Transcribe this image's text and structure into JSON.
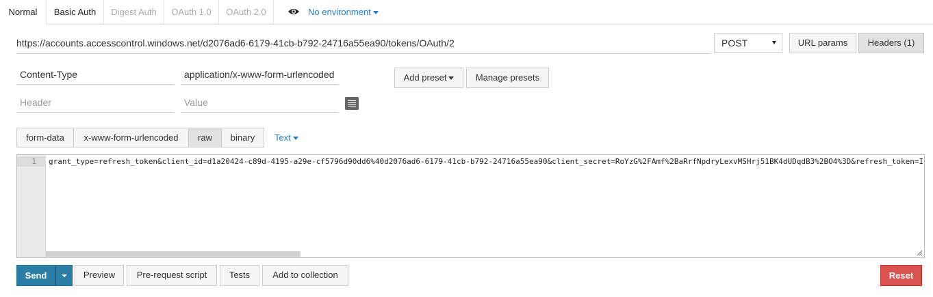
{
  "auth_tabs": [
    {
      "label": "Normal",
      "active": true
    },
    {
      "label": "Basic Auth"
    },
    {
      "label": "Digest Auth"
    },
    {
      "label": "OAuth 1.0"
    },
    {
      "label": "OAuth 2.0"
    }
  ],
  "environment": {
    "label": "No environment"
  },
  "request": {
    "url": "https://accounts.accesscontrol.windows.net/d2076ad6-6179-41cb-b792-24716a55ea90/tokens/OAuth/2",
    "method": "POST"
  },
  "url_buttons": {
    "url_params": "URL params",
    "headers": "Headers (1)"
  },
  "headers": {
    "rows": [
      {
        "key": "Content-Type",
        "value": "application/x-www-form-urlencoded"
      }
    ],
    "new_row": {
      "key_placeholder": "Header",
      "value_placeholder": "Value"
    },
    "add_preset": "Add preset",
    "manage_presets": "Manage presets"
  },
  "body_tabs": [
    {
      "label": "form-data"
    },
    {
      "label": "x-www-form-urlencoded"
    },
    {
      "label": "raw",
      "active": true
    },
    {
      "label": "binary"
    }
  ],
  "text_mode": "Text",
  "editor": {
    "line_number": "1",
    "content": "grant_type=refresh_token&client_id=d1a20424-c89d-4195-a29e-cf5796d90dd6%40d2076ad6-6179-41cb-b792-24716a55ea90&client_secret=RoYzG%2FAmf%2BaRrfNpdryLexvMSHrj51BK4dUDqdB3%2BO4%3D&refresh_token=IA"
  },
  "actions": {
    "send": "Send",
    "preview": "Preview",
    "pre_request": "Pre-request script",
    "tests": "Tests",
    "add_collection": "Add to collection",
    "reset": "Reset"
  }
}
